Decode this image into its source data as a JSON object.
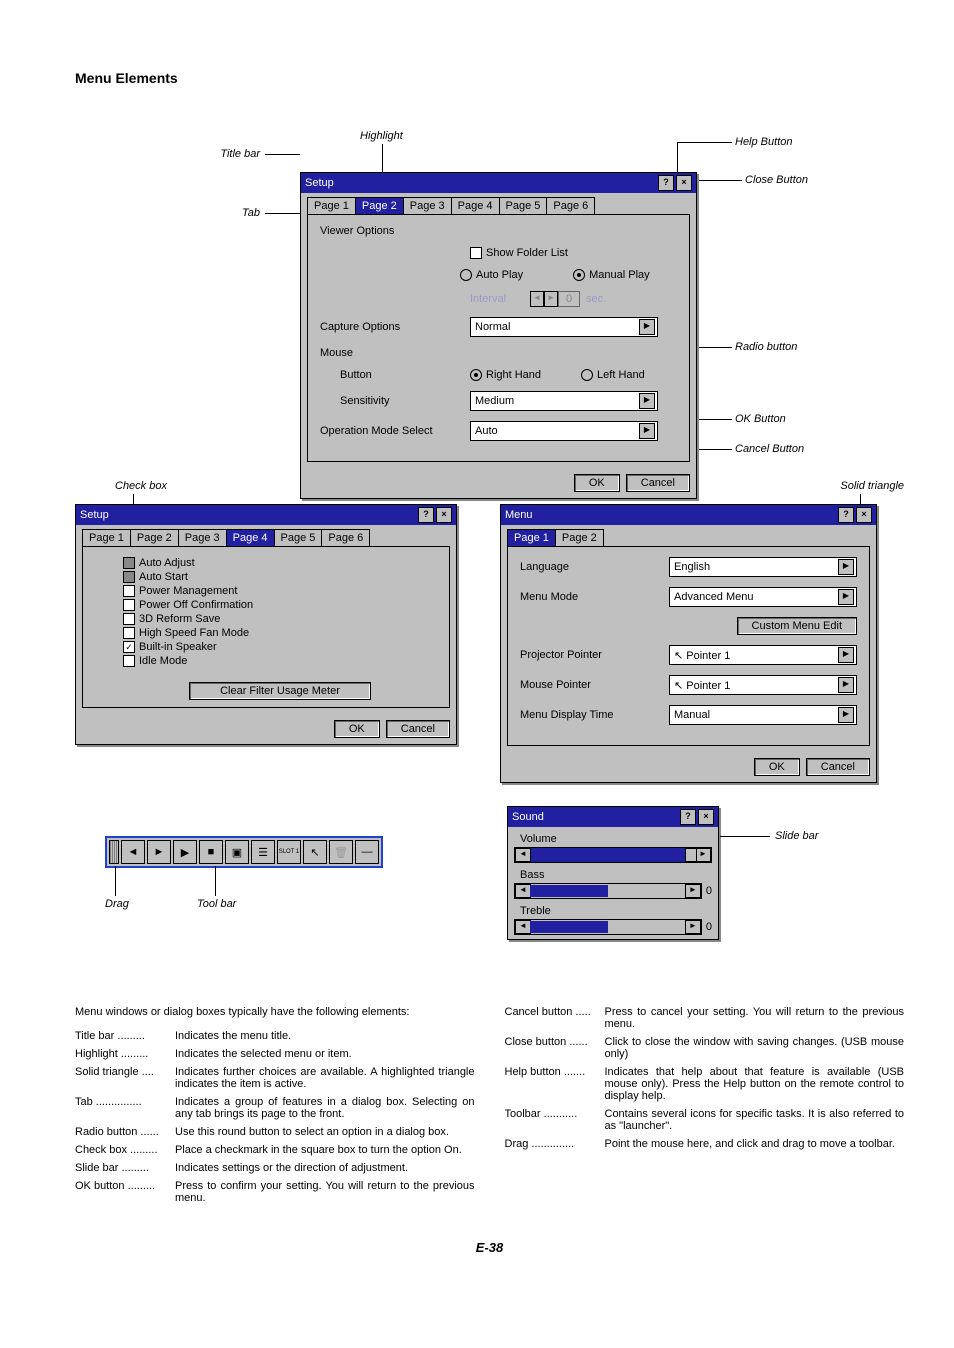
{
  "section_title": "Menu Elements",
  "page_number": "E-38",
  "callouts": {
    "title_bar": "Title bar",
    "tab": "Tab",
    "highlight": "Highlight",
    "help_button": "Help Button",
    "close_button": "Close Button",
    "radio_button": "Radio button",
    "ok_button": "OK Button",
    "cancel_button": "Cancel Button",
    "check_box": "Check box",
    "solid_triangle": "Solid triangle",
    "drag": "Drag",
    "tool_bar": "Tool bar",
    "slide_bar": "Slide bar"
  },
  "dialog1": {
    "title": "Setup",
    "tabs": [
      "Page 1",
      "Page 2",
      "Page 3",
      "Page 4",
      "Page 5",
      "Page 6"
    ],
    "active_tab": 1,
    "viewer_options_label": "Viewer Options",
    "show_folder": "Show Folder List",
    "auto_play": "Auto Play",
    "manual_play": "Manual Play",
    "interval": "Interval",
    "interval_val": "0",
    "interval_unit": "sec.",
    "capture_options_label": "Capture Options",
    "capture_value": "Normal",
    "mouse_label": "Mouse",
    "mouse_button_label": "Button",
    "right_hand": "Right Hand",
    "left_hand": "Left Hand",
    "sensitivity_label": "Sensitivity",
    "sensitivity_value": "Medium",
    "op_mode_label": "Operation Mode Select",
    "op_mode_value": "Auto",
    "ok": "OK",
    "cancel": "Cancel"
  },
  "dialog2": {
    "title": "Setup",
    "tabs": [
      "Page 1",
      "Page 2",
      "Page 3",
      "Page 4",
      "Page 5",
      "Page 6"
    ],
    "active_tab": 3,
    "checks": [
      {
        "label": "Auto Adjust",
        "gray": true
      },
      {
        "label": "Auto Start",
        "gray": true
      },
      {
        "label": "Power Management",
        "gray": false
      },
      {
        "label": "Power Off Confirmation",
        "gray": false
      },
      {
        "label": "3D Reform Save",
        "gray": false
      },
      {
        "label": "High Speed Fan Mode",
        "gray": false
      },
      {
        "label": "Built-in Speaker",
        "gray": false,
        "checked": true
      },
      {
        "label": "Idle Mode",
        "gray": false
      }
    ],
    "clear_btn": "Clear Filter Usage Meter",
    "ok": "OK",
    "cancel": "Cancel"
  },
  "dialog3": {
    "title": "Menu",
    "tabs": [
      "Page 1",
      "Page 2"
    ],
    "active_tab": 0,
    "language_label": "Language",
    "language_value": "English",
    "menu_mode_label": "Menu Mode",
    "menu_mode_value": "Advanced Menu",
    "custom_btn": "Custom Menu Edit",
    "proj_pointer_label": "Projector Pointer",
    "proj_pointer_value": "Pointer 1",
    "mouse_pointer_label": "Mouse Pointer",
    "mouse_pointer_value": "Pointer 1",
    "display_time_label": "Menu Display Time",
    "display_time_value": "Manual",
    "ok": "OK",
    "cancel": "Cancel"
  },
  "dialog4": {
    "title": "Sound",
    "volume": "Volume",
    "bass": "Bass",
    "treble": "Treble",
    "zero": "0"
  },
  "toolbar": {
    "slot": "SLOT 1"
  },
  "intro": "Menu windows or dialog boxes typically have the following elements:",
  "defs_left": [
    {
      "term": "Title bar",
      "desc": "Indicates the menu title."
    },
    {
      "term": "Highlight",
      "desc": "Indicates the selected menu or item."
    },
    {
      "term": "Solid triangle",
      "desc": "Indicates further choices are available. A highlighted triangle indicates the item is active."
    },
    {
      "term": "Tab",
      "desc": "Indicates a group of features in a dialog box. Selecting on any tab brings its page to the front."
    },
    {
      "term": "Radio button",
      "desc": "Use this round button to select an option in a dialog box."
    },
    {
      "term": "Check box",
      "desc": "Place a checkmark in the square box to turn the option On."
    },
    {
      "term": "Slide bar",
      "desc": "Indicates settings or the direction of adjustment."
    },
    {
      "term": "OK button",
      "desc": "Press to confirm your setting. You will return to the previous menu."
    }
  ],
  "defs_right": [
    {
      "term": "Cancel button",
      "desc": "Press to cancel your setting. You will return to the previous menu."
    },
    {
      "term": "Close button",
      "desc": "Click to close the window with saving changes. (USB mouse only)"
    },
    {
      "term": "Help button",
      "desc": "Indicates that help about that feature is available (USB mouse only). Press the Help button on the remote control to display help."
    },
    {
      "term": "Toolbar",
      "desc": "Contains several icons for specific tasks. It is also referred to as \"launcher\"."
    },
    {
      "term": "Drag",
      "desc": "Point the mouse here, and click and drag to move a toolbar."
    }
  ]
}
